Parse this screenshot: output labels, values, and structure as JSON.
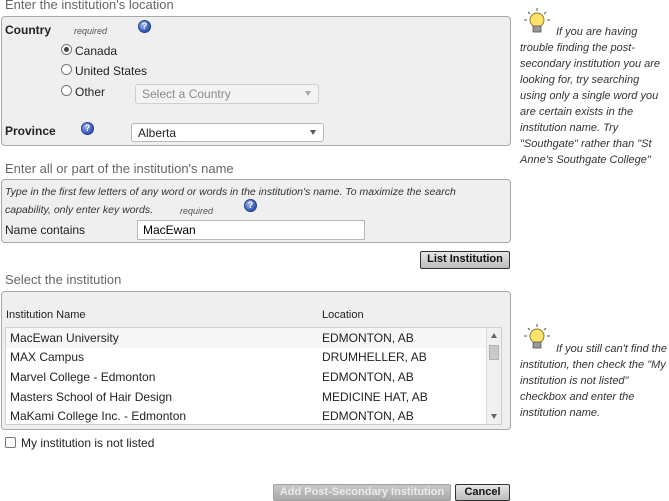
{
  "location_section": {
    "title": "Enter the institution's location",
    "country_label": "Country",
    "required_text": "required",
    "options": [
      "Canada",
      "United States",
      "Other"
    ],
    "selected_option": "Canada",
    "other_select_placeholder": "Select a Country",
    "province_label": "Province",
    "province_value": "Alberta"
  },
  "name_section": {
    "title": "Enter all or part of the institution's name",
    "instruction": "Type in the first few letters of any word or words in the institution's name. To maximize the search capability, only enter key words.",
    "required_text": "required",
    "name_label": "Name contains",
    "name_value": "MacEwan",
    "list_button": "List Institution"
  },
  "select_section": {
    "title": "Select the institution",
    "columns": [
      "Institution Name",
      "Location"
    ],
    "rows": [
      {
        "name": "MacEwan University",
        "location": "EDMONTON, AB"
      },
      {
        "name": "MAX Campus",
        "location": "DRUMHELLER, AB"
      },
      {
        "name": "Marvel College - Edmonton",
        "location": "EDMONTON, AB"
      },
      {
        "name": "Masters School of Hair Design",
        "location": "MEDICINE HAT, AB"
      },
      {
        "name": "MaKami College Inc. - Edmonton",
        "location": "EDMONTON, AB"
      }
    ],
    "not_listed_label": "My institution is not listed"
  },
  "buttons": {
    "add": "Add Post-Secondary Institution",
    "cancel": "Cancel"
  },
  "tips": {
    "tip1": "If you are having trouble finding the post-secondary institution you are looking for, try searching using only a single word you are certain exists in the institution name. Try \"Southgate\" rather than \"St Anne's Southgate College\"",
    "tip2": "If you still can't find the institution, then check the \"My institution is not listed\" checkbox and enter the institution name."
  },
  "icons": [
    "help-icon",
    "lightbulb-icon",
    "radio-button",
    "dropdown-arrow-icon",
    "checkbox"
  ],
  "colors": {
    "panel_bg": "#efefef",
    "panel_border": "#a8a8a8",
    "help_blue": "#2f55b5",
    "section_title": "#666666"
  }
}
